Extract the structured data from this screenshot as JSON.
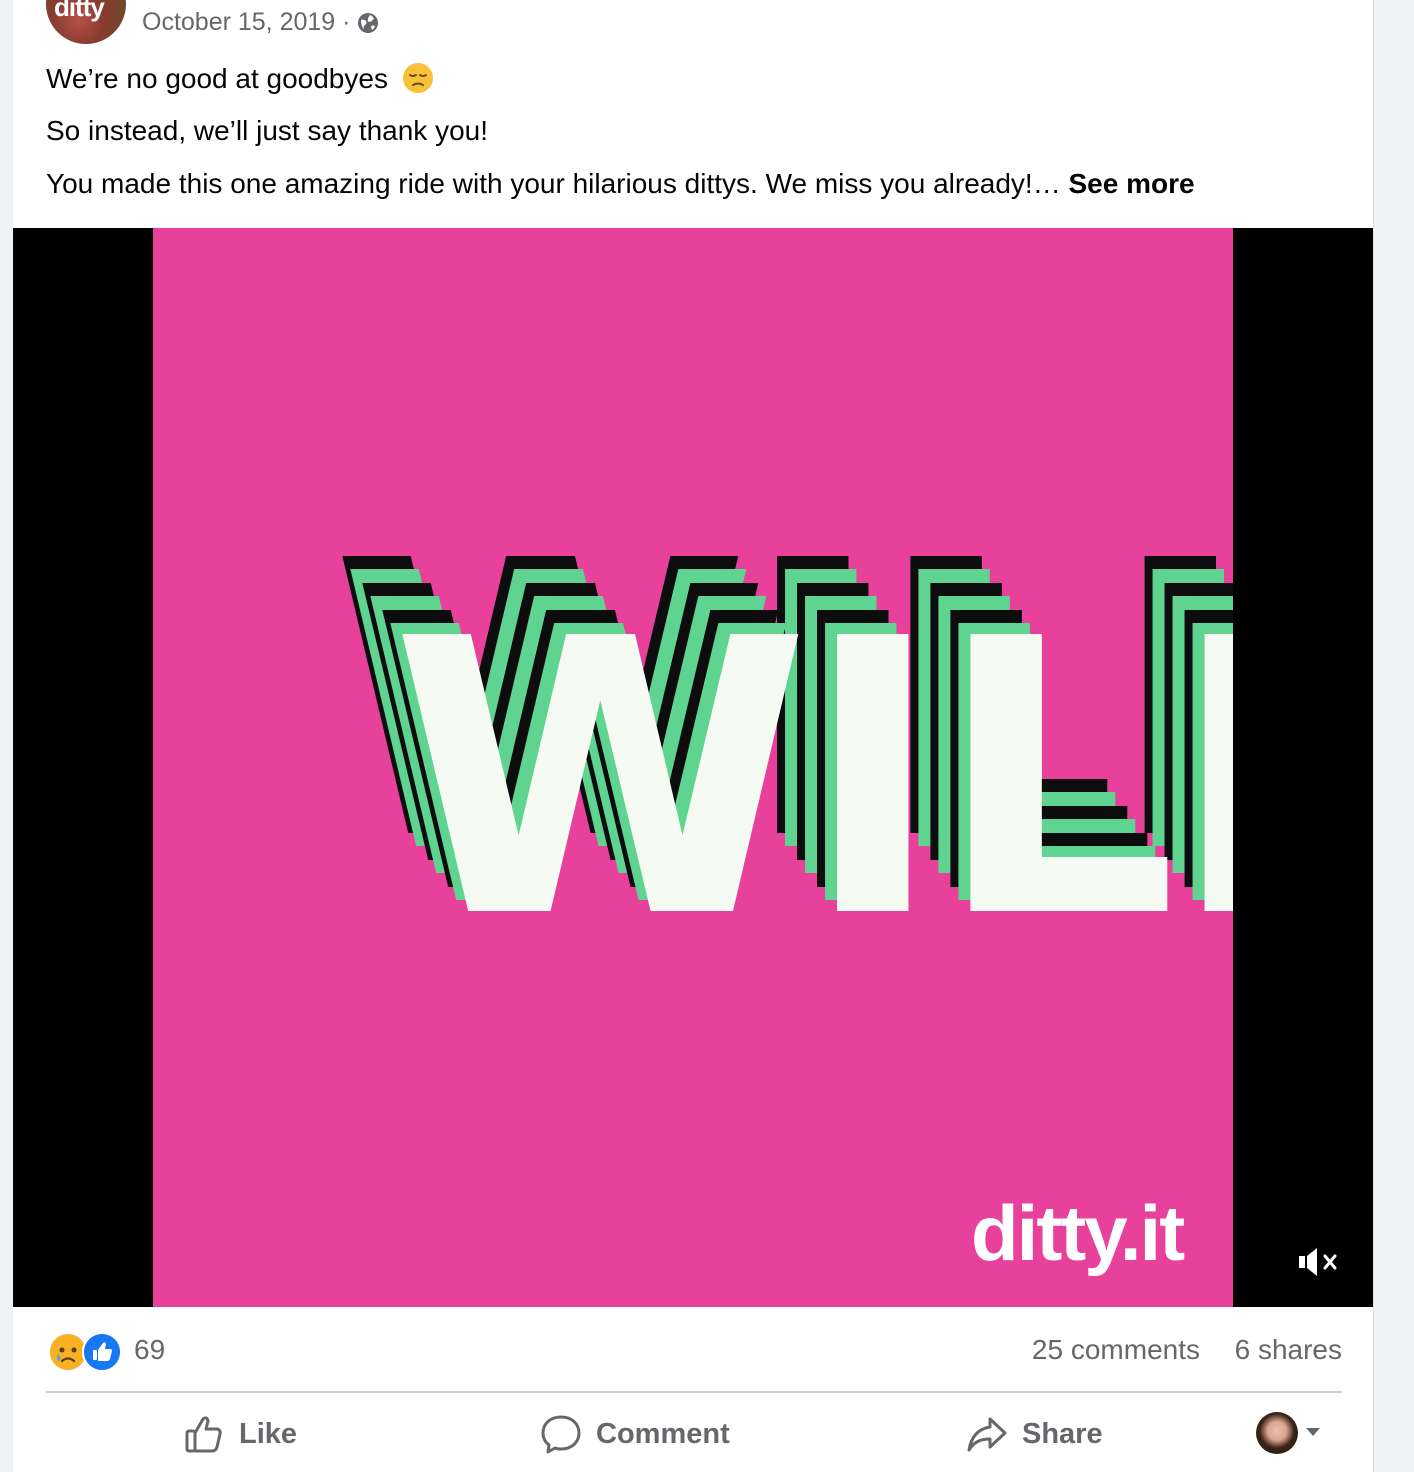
{
  "post": {
    "author_logo": "ditty",
    "date": "October 15, 2019 ·",
    "privacy_icon": "globe-icon",
    "more_icon": "more-options-icon",
    "lines": [
      "We’re no good at goodbyes",
      "So instead, we’ll just say thank you!",
      "You made this one amazing ride with your hilarious dittys. We miss you already!…"
    ],
    "line1_emoji": "pensive-face-emoji",
    "see_more": "See more"
  },
  "video": {
    "big_word": "WILL",
    "watermark": "ditty.it",
    "mute_icon": "muted-speaker-icon",
    "colors": {
      "background": "#e8419b",
      "letter_fill": "#f5fbf2",
      "shadow_green": "#5fd490",
      "shadow_dark": "#0d0d10"
    }
  },
  "stats": {
    "reactions": [
      "sad-reaction-icon",
      "like-reaction-icon"
    ],
    "reaction_count": "69",
    "comments": "25 comments",
    "shares": "6 shares"
  },
  "actions": {
    "like": "Like",
    "comment": "Comment",
    "share": "Share"
  },
  "colors": {
    "accent": "#1877f2",
    "muted_text": "#65676b",
    "text": "#050505"
  }
}
